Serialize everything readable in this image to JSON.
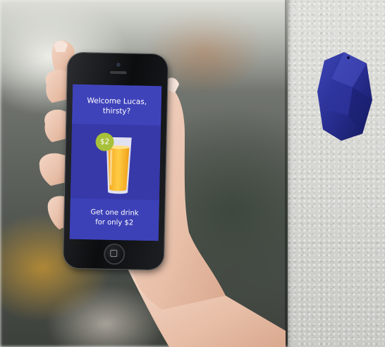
{
  "phone_app": {
    "greeting_line1": "Welcome Lucas,",
    "greeting_line2": "thirsty?",
    "price_badge": "$2",
    "offer_line1": "Get one drink",
    "offer_line2": "for only $2"
  },
  "colors": {
    "screen_background": "#3b3fb4",
    "price_badge": "#a7c13a",
    "beacon": "#2a2f8f",
    "wall": "#d8d8d4"
  },
  "icons": {
    "drink": "orange-juice-glass-icon",
    "beacon": "estimote-beacon-icon"
  }
}
